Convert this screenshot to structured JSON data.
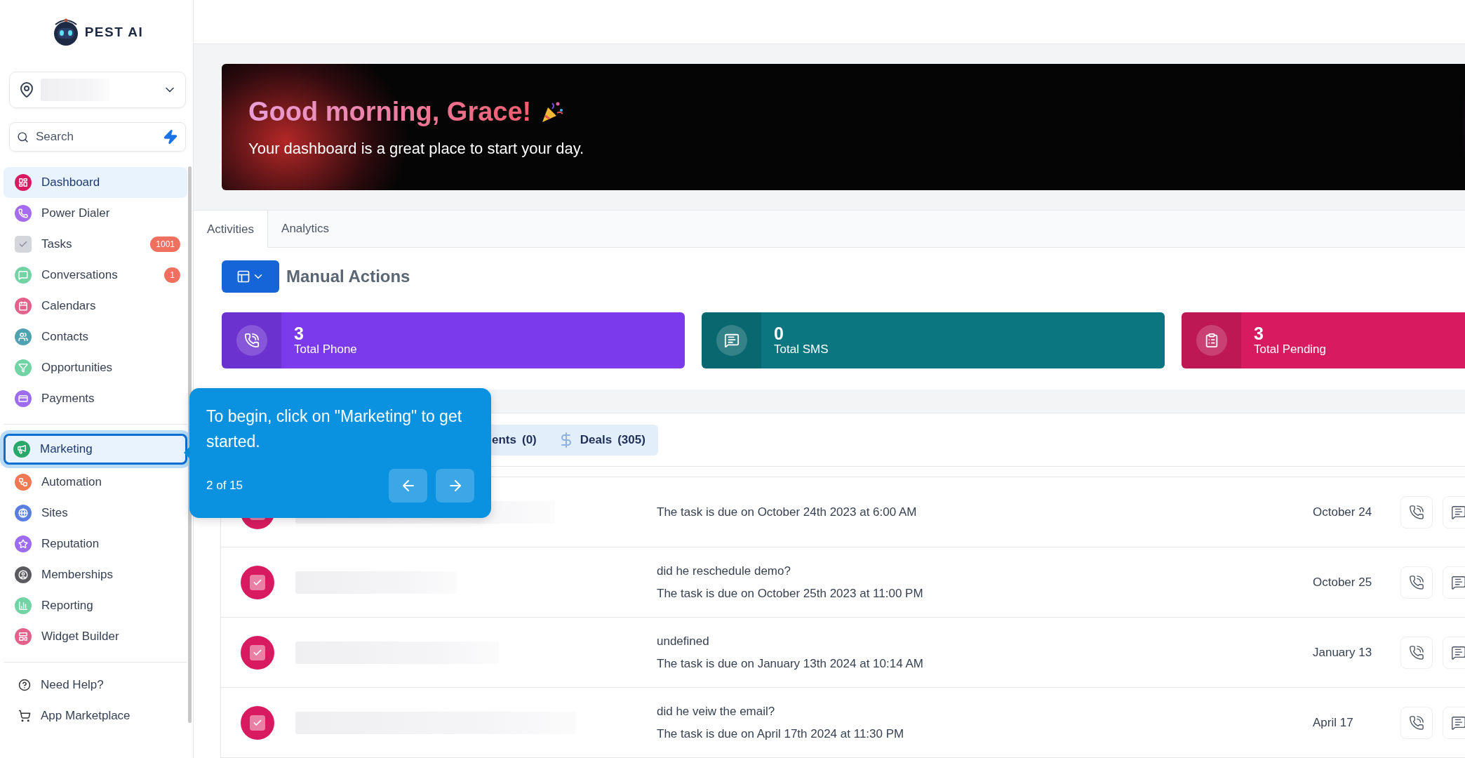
{
  "logo": {
    "text": "PEST AI"
  },
  "search": {
    "placeholder": "Search"
  },
  "nav": [
    {
      "label": "Dashboard",
      "selected": true,
      "color": "#d81b60"
    },
    {
      "label": "Power Dialer",
      "selected": false,
      "color": "#a66cf0"
    },
    {
      "label": "Tasks",
      "selected": false,
      "color": "#d4d6dc",
      "badge": "1001"
    },
    {
      "label": "Conversations",
      "selected": false,
      "color": "#72d3a4",
      "badge": "1"
    },
    {
      "label": "Calendars",
      "selected": false,
      "color": "#e2628c"
    },
    {
      "label": "Contacts",
      "selected": false,
      "color": "#4fa3b0"
    },
    {
      "label": "Opportunities",
      "selected": false,
      "color": "#72d3a4"
    },
    {
      "label": "Payments",
      "selected": false,
      "color": "#9d6cf0"
    }
  ],
  "nav_secondary": [
    {
      "label": "Marketing",
      "highlighted": true,
      "color": "#2aa86c"
    },
    {
      "label": "Automation",
      "highlighted": false,
      "color": "#f27a52"
    },
    {
      "label": "Sites",
      "highlighted": false,
      "color": "#5a7fe0"
    },
    {
      "label": "Reputation",
      "highlighted": false,
      "color": "#9d6cf0"
    },
    {
      "label": "Memberships",
      "highlighted": false,
      "color": "#5b5b5f"
    },
    {
      "label": "Reporting",
      "highlighted": false,
      "color": "#72d3a4"
    },
    {
      "label": "Widget Builder",
      "highlighted": false,
      "color": "#e2628c"
    }
  ],
  "help_links": [
    {
      "label": "Need Help?"
    },
    {
      "label": "App Marketplace"
    }
  ],
  "banner": {
    "title": "Good morning, Grace!",
    "subtitle": "Your dashboard is a great place to start your day."
  },
  "tabs": [
    {
      "label": "Activities",
      "selected": true
    },
    {
      "label": "Analytics",
      "selected": false
    }
  ],
  "section_title": "Manual Actions",
  "stat_cards": [
    {
      "value": "3",
      "label": "Total Phone",
      "color": "#7c3aed"
    },
    {
      "value": "0",
      "label": "Total SMS",
      "color": "#0b7680"
    },
    {
      "value": "3",
      "label": "Total Pending",
      "color": "#d81b60"
    }
  ],
  "filters": [
    {
      "label": "ents",
      "count": "(0)"
    },
    {
      "label": "Deals",
      "count": "(305)"
    }
  ],
  "tasks": [
    {
      "checked": true,
      "due": "The task is due on October 24th 2023 at 6:00 AM",
      "date": "October 24"
    },
    {
      "checked": true,
      "title": "did he reschedule demo?",
      "due": "The task is due on October 25th 2023 at 11:00 PM",
      "date": "October 25"
    },
    {
      "checked": true,
      "title": "undefined",
      "due": "The task is due on January 13th 2024 at 10:14 AM",
      "date": "January 13"
    },
    {
      "checked": true,
      "title": "did he veiw the email?",
      "due": "The task is due on April 17th 2024 at 11:30 PM",
      "date": "April 17"
    }
  ],
  "tour": {
    "text": "To begin, click on \"Marketing\" to get started.",
    "step": "2 of 15"
  }
}
